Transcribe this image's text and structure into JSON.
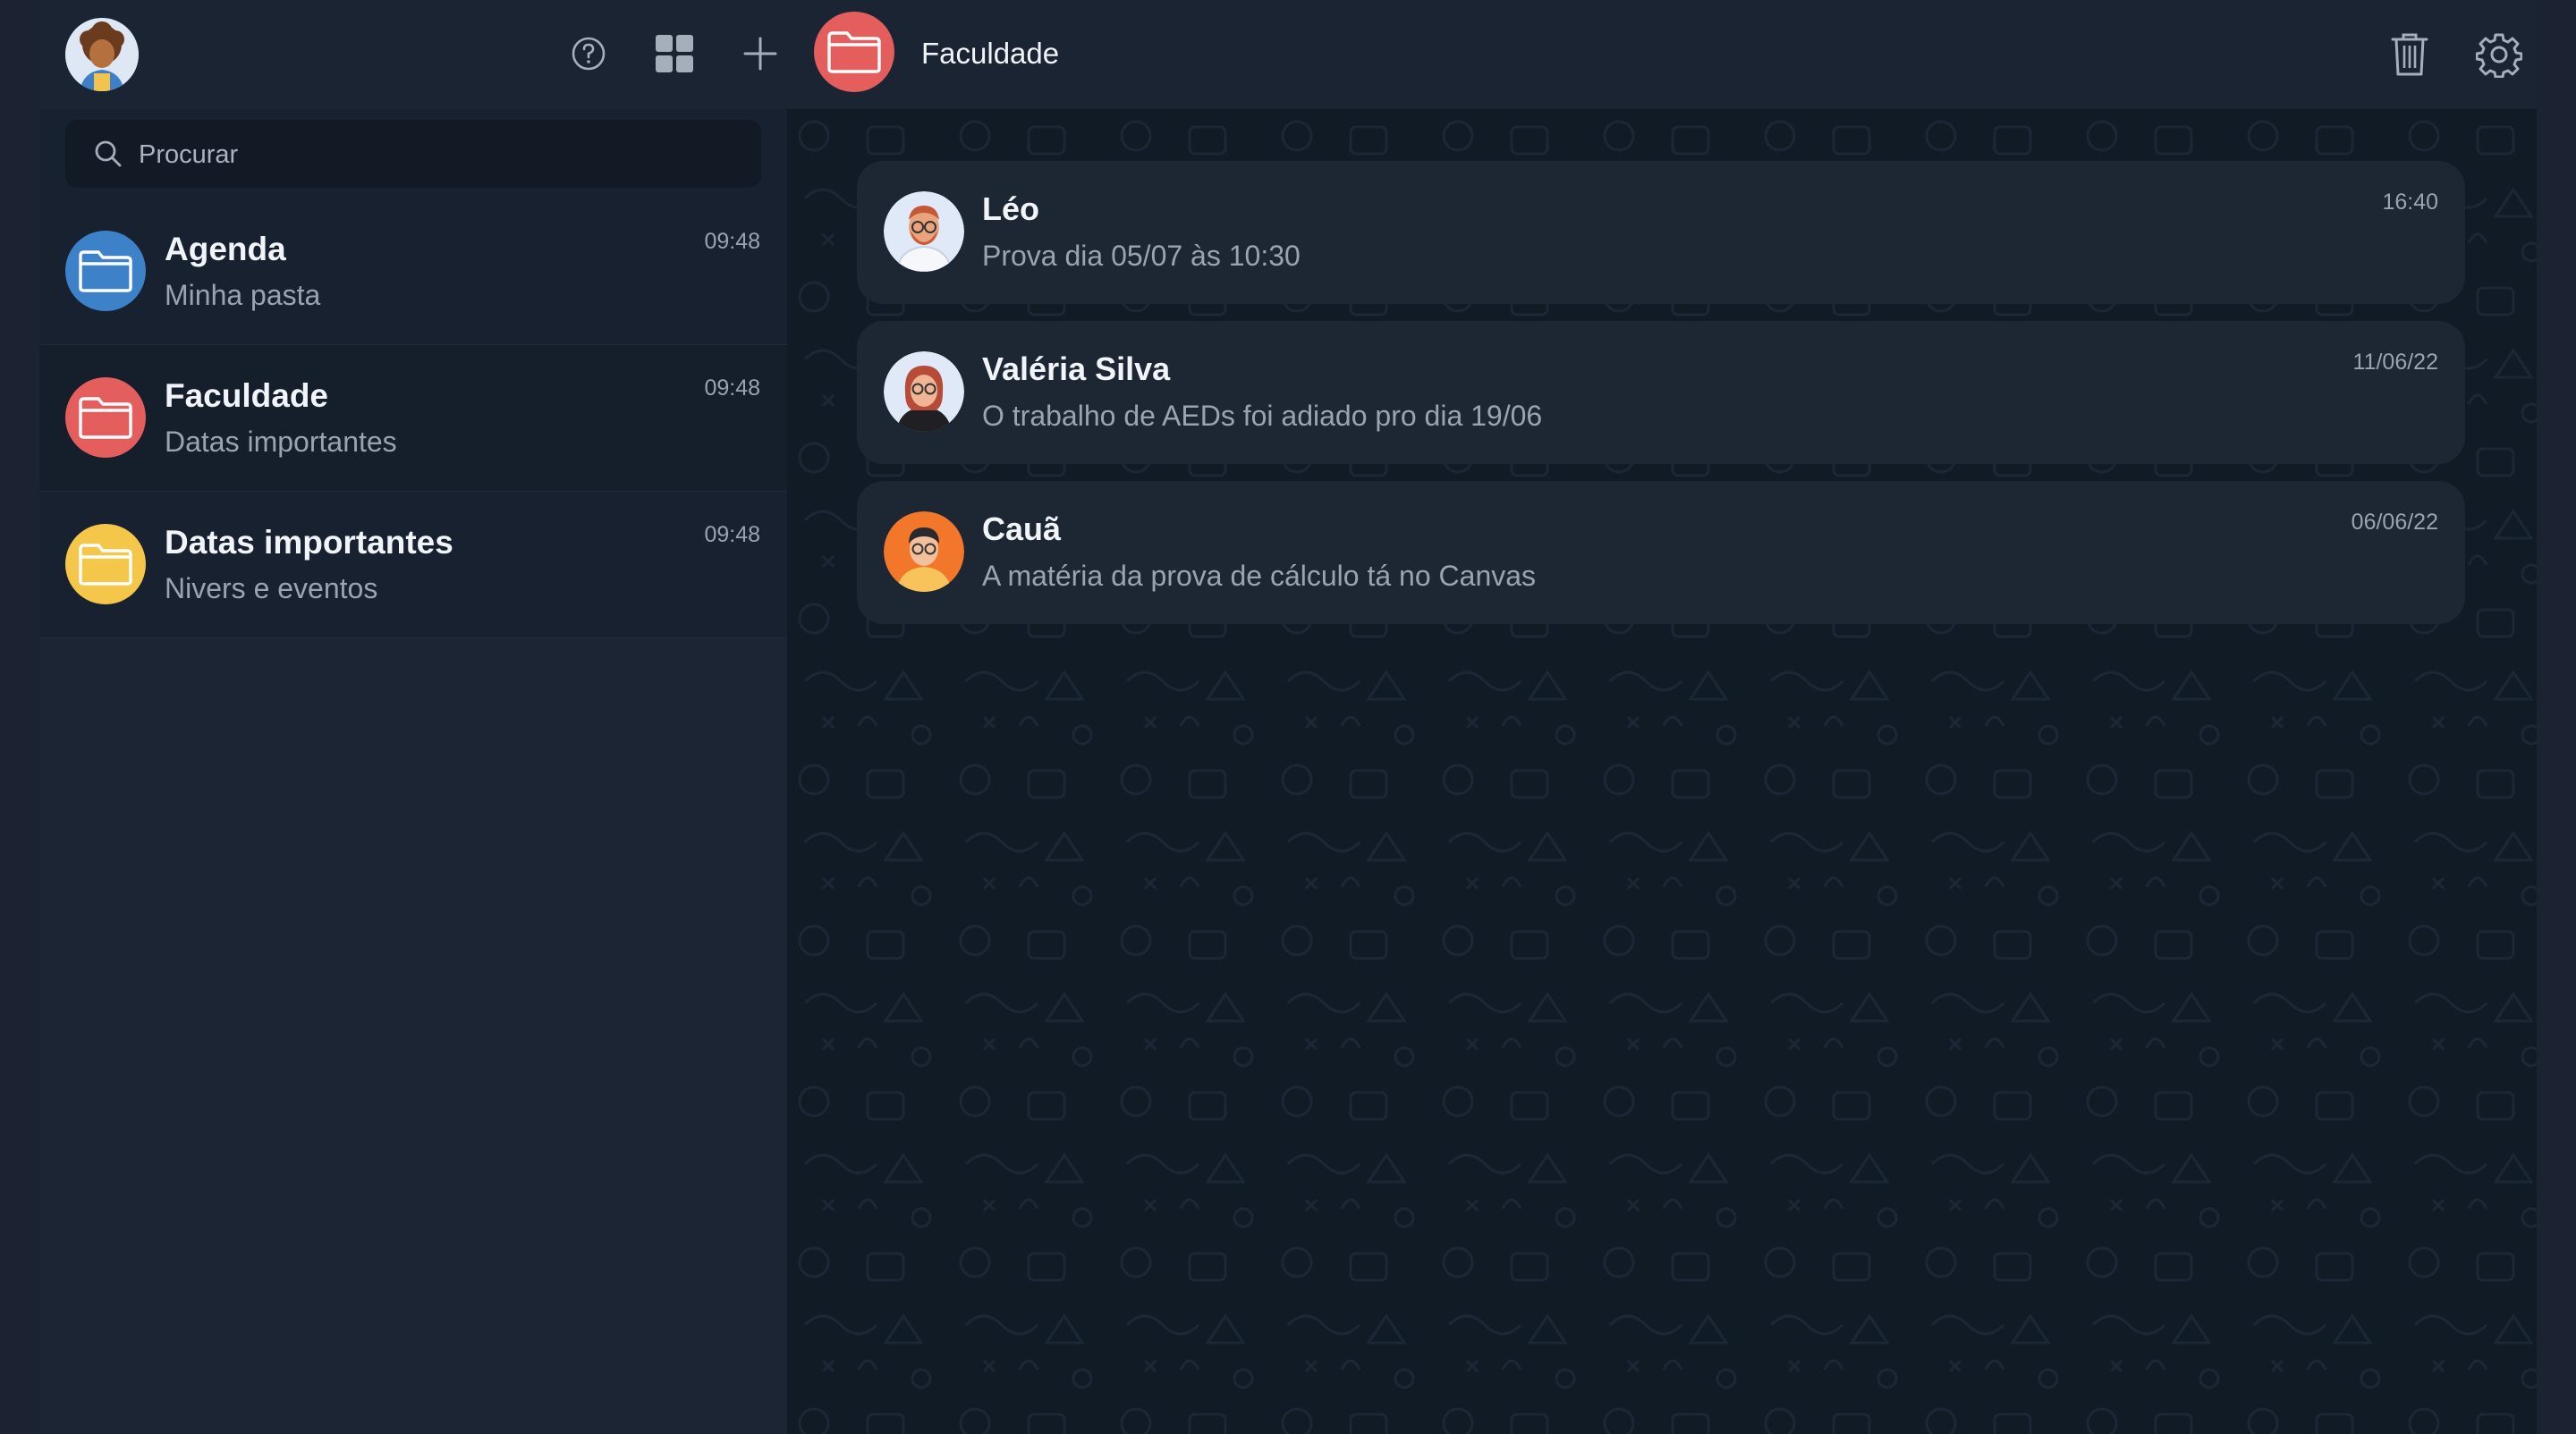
{
  "sidebar": {
    "header": {
      "profile_alt": "Perfil",
      "icons": [
        "help-icon",
        "grid-icon",
        "plus-icon"
      ]
    },
    "search": {
      "placeholder": "Procurar"
    },
    "folders": [
      {
        "name": "Agenda",
        "subtitle": "Minha pasta",
        "time": "09:48",
        "color": "#3d82c9"
      },
      {
        "name": "Faculdade",
        "subtitle": "Datas importantes",
        "time": "09:48",
        "color": "#e45e5e"
      },
      {
        "name": "Datas importantes",
        "subtitle": "Nivers e eventos",
        "time": "09:48",
        "color": "#f4c64a"
      }
    ]
  },
  "main": {
    "header": {
      "title": "Faculdade",
      "color": "#e45e5e",
      "actions": [
        "trash-icon",
        "settings-icon"
      ]
    },
    "messages": [
      {
        "name": "Léo",
        "text": "Prova dia 05/07 às 10:30",
        "time": "16:40"
      },
      {
        "name": "Valéria Silva",
        "text": "O trabalho de AEDs foi adiado pro dia 19/06",
        "time": "11/06/22"
      },
      {
        "name": "Cauã",
        "text": "A matéria da prova de cálculo tá no Canvas",
        "time": "06/06/22"
      }
    ]
  }
}
